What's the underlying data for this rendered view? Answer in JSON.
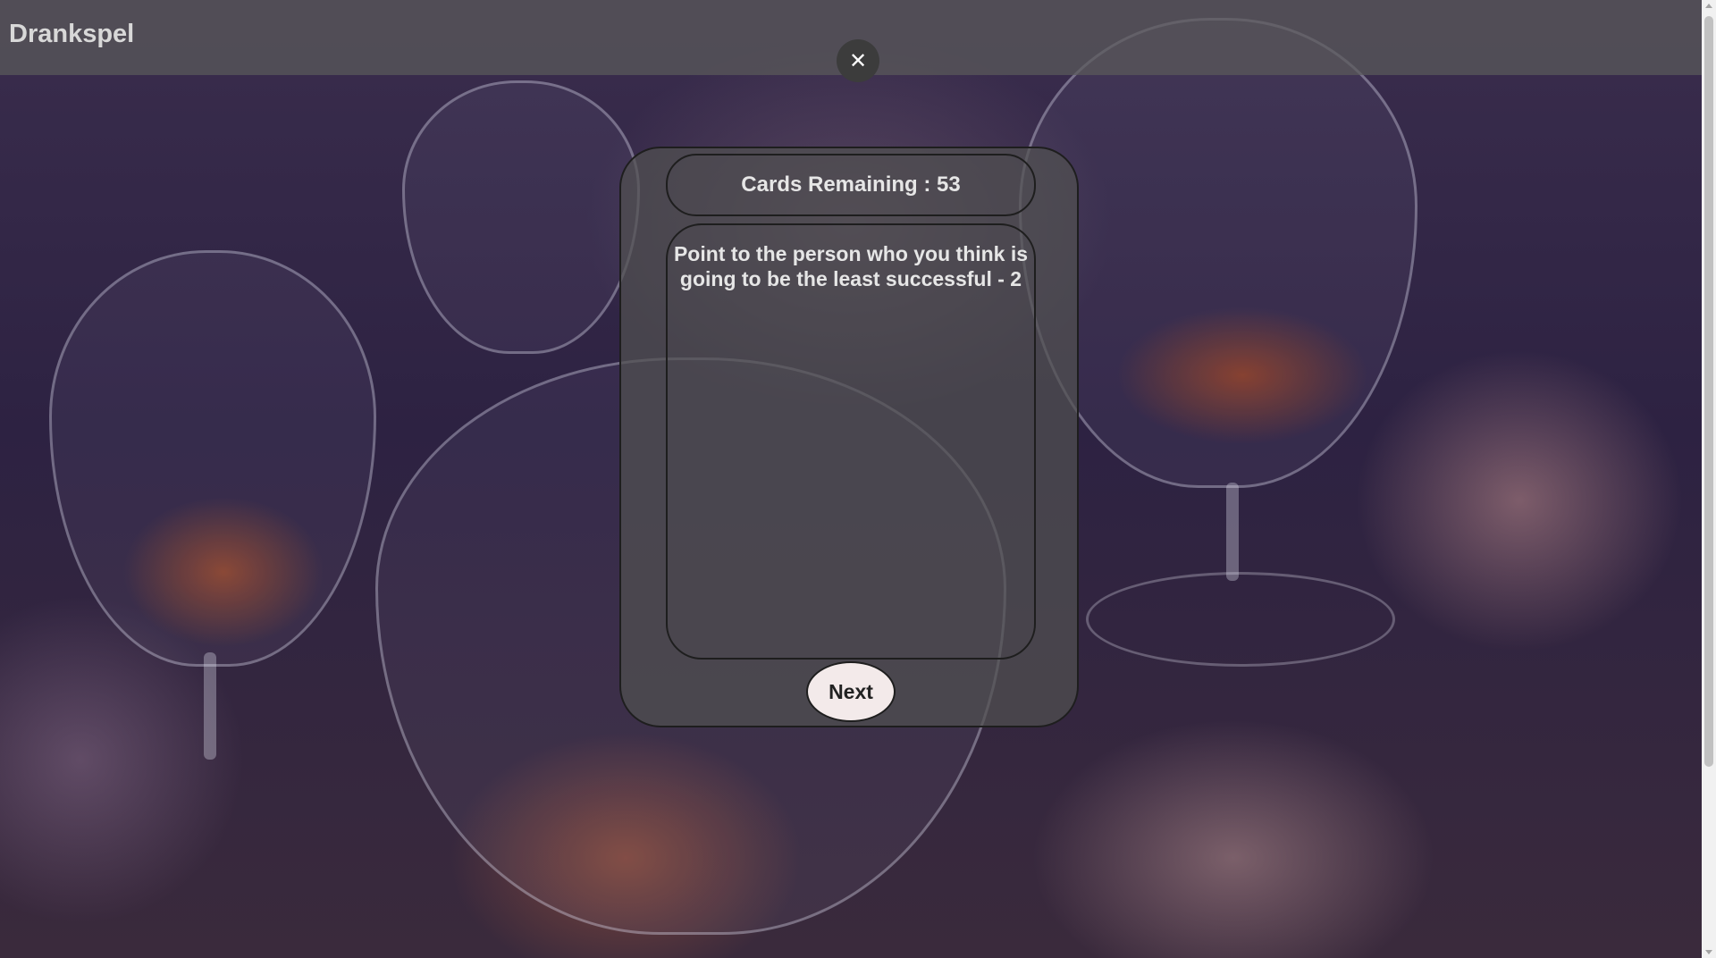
{
  "app": {
    "title": "Drankspel"
  },
  "dialog": {
    "close_icon": "close-icon",
    "close_glyph": "✕",
    "cards_remaining_label": "Cards Remaining : 53",
    "prompt_text": "Point to the person who you think is going to be the least successful - 2",
    "next_label": "Next"
  },
  "colors": {
    "topbar": "#5a5a5a",
    "panel": "#505050",
    "text": "#e6e6e6",
    "next_button_bg": "#f3eaea"
  }
}
